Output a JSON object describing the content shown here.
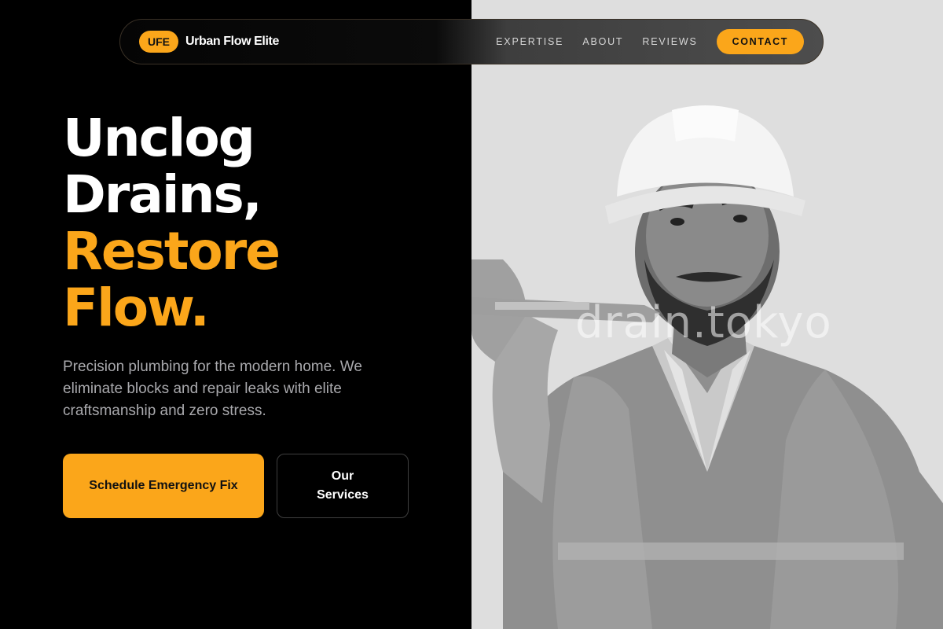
{
  "brand": {
    "badge": "UFE",
    "name": "Urban Flow Elite"
  },
  "nav": {
    "links": [
      "EXPERTISE",
      "ABOUT",
      "REVIEWS"
    ],
    "contact": "CONTACT"
  },
  "hero": {
    "headline_line1": "Unclog",
    "headline_line2": "Drains,",
    "headline_line3": "Restore",
    "headline_line4": "Flow.",
    "lead": "Precision plumbing for the modern home. We eliminate blocks and repair leaks with elite craftsmanship and zero stress.",
    "primary_cta": "Schedule Emergency Fix",
    "secondary_cta": "Our Services"
  },
  "image": {
    "watermark": "drain.tokyo"
  },
  "colors": {
    "accent": "#fba61a",
    "background": "#000000",
    "photo_bg": "#dedede"
  }
}
